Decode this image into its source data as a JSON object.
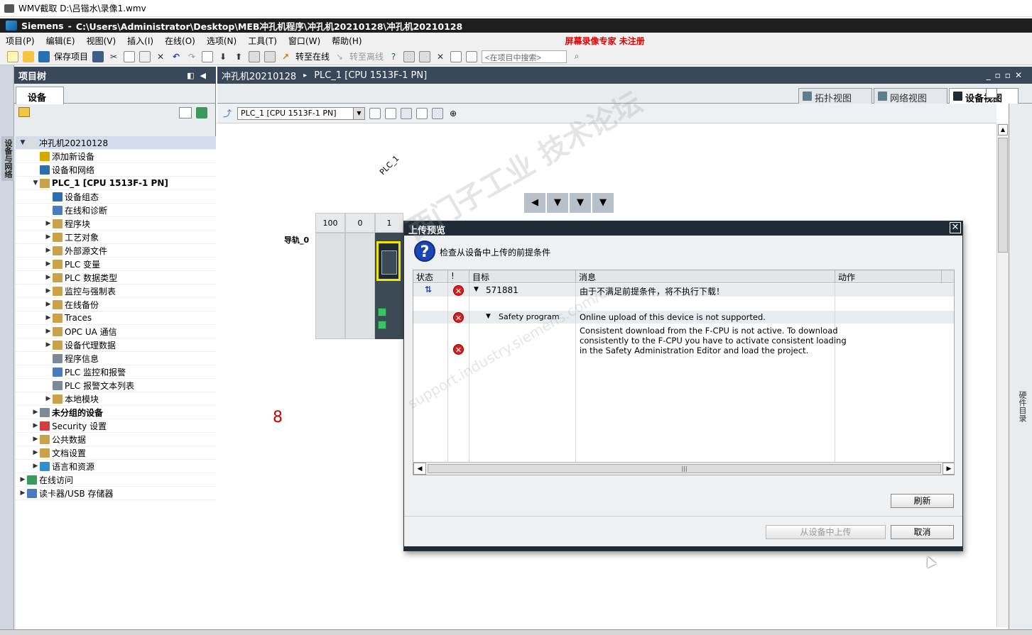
{
  "wmv_title": "WMV截取 D:\\吕锴水\\录像1.wmv",
  "app": {
    "name": "Siemens",
    "sep": "-",
    "path": "C:\\Users\\Administrator\\Desktop\\MEB冲孔机程序\\冲孔机20210128\\冲孔机20210128"
  },
  "menu": {
    "items": [
      "项目(P)",
      "编辑(E)",
      "视图(V)",
      "插入(I)",
      "在线(O)",
      "选项(N)",
      "工具(T)",
      "窗口(W)",
      "帮助(H)"
    ],
    "warning": "屏幕录像专家 未注册"
  },
  "toolbar": {
    "save_label": "保存项目",
    "go_online": "转至在线",
    "go_offline": "转至离线",
    "search_placeholder": "<在项目中搜索>"
  },
  "sidestrip_label": "设备与网络",
  "project_tree": {
    "title": "项目树",
    "tab": "设备",
    "items": [
      {
        "label": "冲孔机20210128",
        "indent": 0,
        "arrow": "▼",
        "bold": false,
        "sel": true,
        "color": "#d8dde3"
      },
      {
        "label": "添加新设备",
        "indent": 1,
        "arrow": "",
        "bold": false,
        "color": "#d7a700"
      },
      {
        "label": "设备和网络",
        "indent": 1,
        "arrow": "",
        "bold": false,
        "color": "#2a6fb0"
      },
      {
        "label": "PLC_1 [CPU 1513F-1 PN]",
        "indent": 1,
        "arrow": "▼",
        "bold": true,
        "color": "#c9a24a"
      },
      {
        "label": "设备组态",
        "indent": 2,
        "arrow": "",
        "bold": false,
        "color": "#2a6fb0"
      },
      {
        "label": "在线和诊断",
        "indent": 2,
        "arrow": "",
        "bold": false,
        "color": "#4a7bbf"
      },
      {
        "label": "程序块",
        "indent": 2,
        "arrow": "▶",
        "bold": false,
        "color": "#c9a24a"
      },
      {
        "label": "工艺对象",
        "indent": 2,
        "arrow": "▶",
        "bold": false,
        "color": "#c9a24a"
      },
      {
        "label": "外部源文件",
        "indent": 2,
        "arrow": "▶",
        "bold": false,
        "color": "#c9a24a"
      },
      {
        "label": "PLC 变量",
        "indent": 2,
        "arrow": "▶",
        "bold": false,
        "color": "#c9a24a"
      },
      {
        "label": "PLC 数据类型",
        "indent": 2,
        "arrow": "▶",
        "bold": false,
        "color": "#c9a24a"
      },
      {
        "label": "监控与强制表",
        "indent": 2,
        "arrow": "▶",
        "bold": false,
        "color": "#c9a24a"
      },
      {
        "label": "在线备份",
        "indent": 2,
        "arrow": "▶",
        "bold": false,
        "color": "#c9a24a"
      },
      {
        "label": "Traces",
        "indent": 2,
        "arrow": "▶",
        "bold": false,
        "color": "#c9a24a"
      },
      {
        "label": "OPC UA 通信",
        "indent": 2,
        "arrow": "▶",
        "bold": false,
        "color": "#c9a24a"
      },
      {
        "label": "设备代理数据",
        "indent": 2,
        "arrow": "▶",
        "bold": false,
        "color": "#c9a24a"
      },
      {
        "label": "程序信息",
        "indent": 2,
        "arrow": "",
        "bold": false,
        "color": "#7a8a99"
      },
      {
        "label": "PLC 监控和报警",
        "indent": 2,
        "arrow": "",
        "bold": false,
        "color": "#4a7bbf"
      },
      {
        "label": "PLC 报警文本列表",
        "indent": 2,
        "arrow": "",
        "bold": false,
        "color": "#7a8a99"
      },
      {
        "label": "本地模块",
        "indent": 2,
        "arrow": "▶",
        "bold": false,
        "color": "#c9a24a"
      },
      {
        "label": "未分组的设备",
        "indent": 1,
        "arrow": "▶",
        "bold": true,
        "color": "#7a8a99"
      },
      {
        "label": "Security 设置",
        "indent": 1,
        "arrow": "▶",
        "bold": false,
        "color": "#d04040"
      },
      {
        "label": "公共数据",
        "indent": 1,
        "arrow": "▶",
        "bold": false,
        "color": "#c9a24a"
      },
      {
        "label": "文档设置",
        "indent": 1,
        "arrow": "▶",
        "bold": false,
        "color": "#c9a24a"
      },
      {
        "label": "语言和资源",
        "indent": 1,
        "arrow": "▶",
        "bold": false,
        "color": "#2f8fd0"
      },
      {
        "label": "在线访问",
        "indent": 0,
        "arrow": "▶",
        "bold": false,
        "color": "#3a9a5a"
      },
      {
        "label": "读卡器/USB 存储器",
        "indent": 0,
        "arrow": "▶",
        "bold": false,
        "color": "#4a7bbf"
      }
    ]
  },
  "editor": {
    "breadcrumb": [
      "冲孔机20210128",
      "PLC_1 [CPU 1513F-1 PN]"
    ],
    "crumb_sep": "▸",
    "view_tabs": [
      "拓扑视图",
      "网络视图",
      "设备视图"
    ],
    "device_select": "PLC_1 [CPU 1513F-1 PN]",
    "plc_label": "PLC_1",
    "rail_label": "导轨_0",
    "slots": [
      "100",
      "0",
      "1"
    ],
    "annotation": "8",
    "right_strip_label": "硬件目录"
  },
  "dialog": {
    "title": "上传预览",
    "heading": "检查从设备中上传的前提条件",
    "columns": [
      "状态",
      "!",
      "目标",
      "消息",
      "动作"
    ],
    "rows": [
      {
        "target": "571881",
        "message": "由于不满足前提条件，将不执行下载！"
      },
      {
        "target": "Safety program",
        "message": "Online upload of this device is not supported."
      },
      {
        "target": "",
        "message_lines": [
          "Consistent download from the F-CPU is not active. To download",
          "consistently to the F-CPU you have to activate consistent loading",
          "in the Safety Administration Editor and load the project."
        ]
      }
    ],
    "refresh_button": "刷新",
    "upload_button": "从设备中上传",
    "cancel_button": "取消"
  },
  "watermark": {
    "main": "西门子工业 技术论坛",
    "sub": "support.industry.siemens.com/cs"
  }
}
